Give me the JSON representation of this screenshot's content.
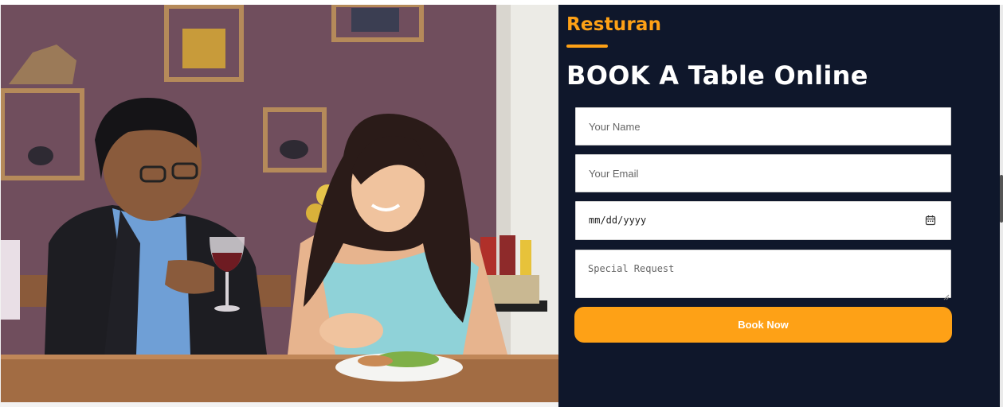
{
  "brand": {
    "name": "Resturan",
    "accent_color": "#fea116"
  },
  "booking": {
    "heading": "BOOK A Table Online",
    "name_placeholder": "Your Name",
    "email_placeholder": "Your Email",
    "date_placeholder": "mm/dd/yyyy",
    "request_placeholder": "Special Request",
    "submit_label": "Book Now",
    "panel_color": "#0f172b"
  },
  "photo": {
    "subject": "couple-dining-photo"
  }
}
